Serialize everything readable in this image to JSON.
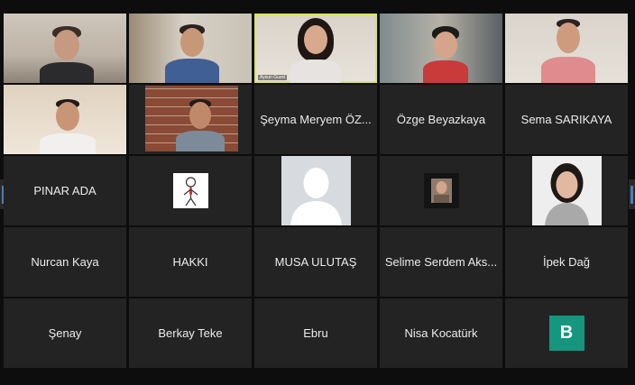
{
  "participants": [
    {
      "name": "",
      "type": "video"
    },
    {
      "name": "",
      "type": "video"
    },
    {
      "name": "Aysun Guzel",
      "type": "video",
      "active": true
    },
    {
      "name": "",
      "type": "video"
    },
    {
      "name": "",
      "type": "video"
    },
    {
      "name": "",
      "type": "video"
    },
    {
      "name": "",
      "type": "video"
    },
    {
      "name": "Şeyma Meryem ÖZ...",
      "type": "text"
    },
    {
      "name": "Özge Beyazkaya",
      "type": "text"
    },
    {
      "name": "Sema SARIKAYA",
      "type": "text"
    },
    {
      "name": "PINAR ADA",
      "type": "text"
    },
    {
      "name": "",
      "type": "image",
      "image": "cartoon-man-red-tie"
    },
    {
      "name": "",
      "type": "image",
      "image": "default-silhouette"
    },
    {
      "name": "",
      "type": "image",
      "image": "small-profile-photo"
    },
    {
      "name": "",
      "type": "image",
      "image": "profile-photo-woman"
    },
    {
      "name": "Nurcan Kaya",
      "type": "text"
    },
    {
      "name": "HAKKI",
      "type": "text"
    },
    {
      "name": "MUSA ULUTAŞ",
      "type": "text"
    },
    {
      "name": "Selime Serdem Aks...",
      "type": "text"
    },
    {
      "name": "İpek Dağ",
      "type": "text"
    },
    {
      "name": "Şenay",
      "type": "text"
    },
    {
      "name": "Berkay Teke",
      "type": "text"
    },
    {
      "name": "Ebru",
      "type": "text"
    },
    {
      "name": "Nisa Kocatürk",
      "type": "text"
    },
    {
      "name": "",
      "type": "avatar",
      "initial": "B",
      "color": "#15967f"
    }
  ],
  "colors": {
    "background": "#0d0d0d",
    "tile": "#232323",
    "active_border": "#d9e65a"
  },
  "navigation": {
    "prev_icon": "chevron-left-icon",
    "next_icon": "chevron-right-icon"
  }
}
